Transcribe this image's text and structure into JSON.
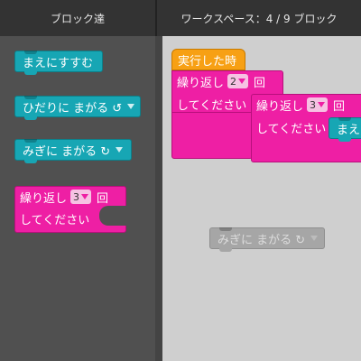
{
  "header": {
    "toolbox_title": "ブロック達",
    "workspace_title": "ワークスペース：4 / 9 ブロック"
  },
  "toolbox": {
    "forward": "まえにすすむ",
    "turn_left": "ひだりに まがる ↺",
    "turn_right": "みぎに まがる ↻",
    "repeat_label": "繰り返し",
    "repeat_count": "3",
    "repeat_unit": "回",
    "repeat_do": "してください"
  },
  "workspace": {
    "when_run": "実行した時",
    "outer_repeat_label": "繰り返し",
    "outer_repeat_count": "2",
    "outer_repeat_unit": "回",
    "outer_repeat_do": "してください",
    "inner_repeat_label": "繰り返し",
    "inner_repeat_count": "3",
    "inner_repeat_unit": "回",
    "inner_repeat_do": "してください",
    "inner_forward": "まえ",
    "ghost_turn_right": "みぎに まがる ↻"
  },
  "colors": {
    "motion": "#17a6b4",
    "loop": "#ee1fa4",
    "event": "#f7a014"
  }
}
